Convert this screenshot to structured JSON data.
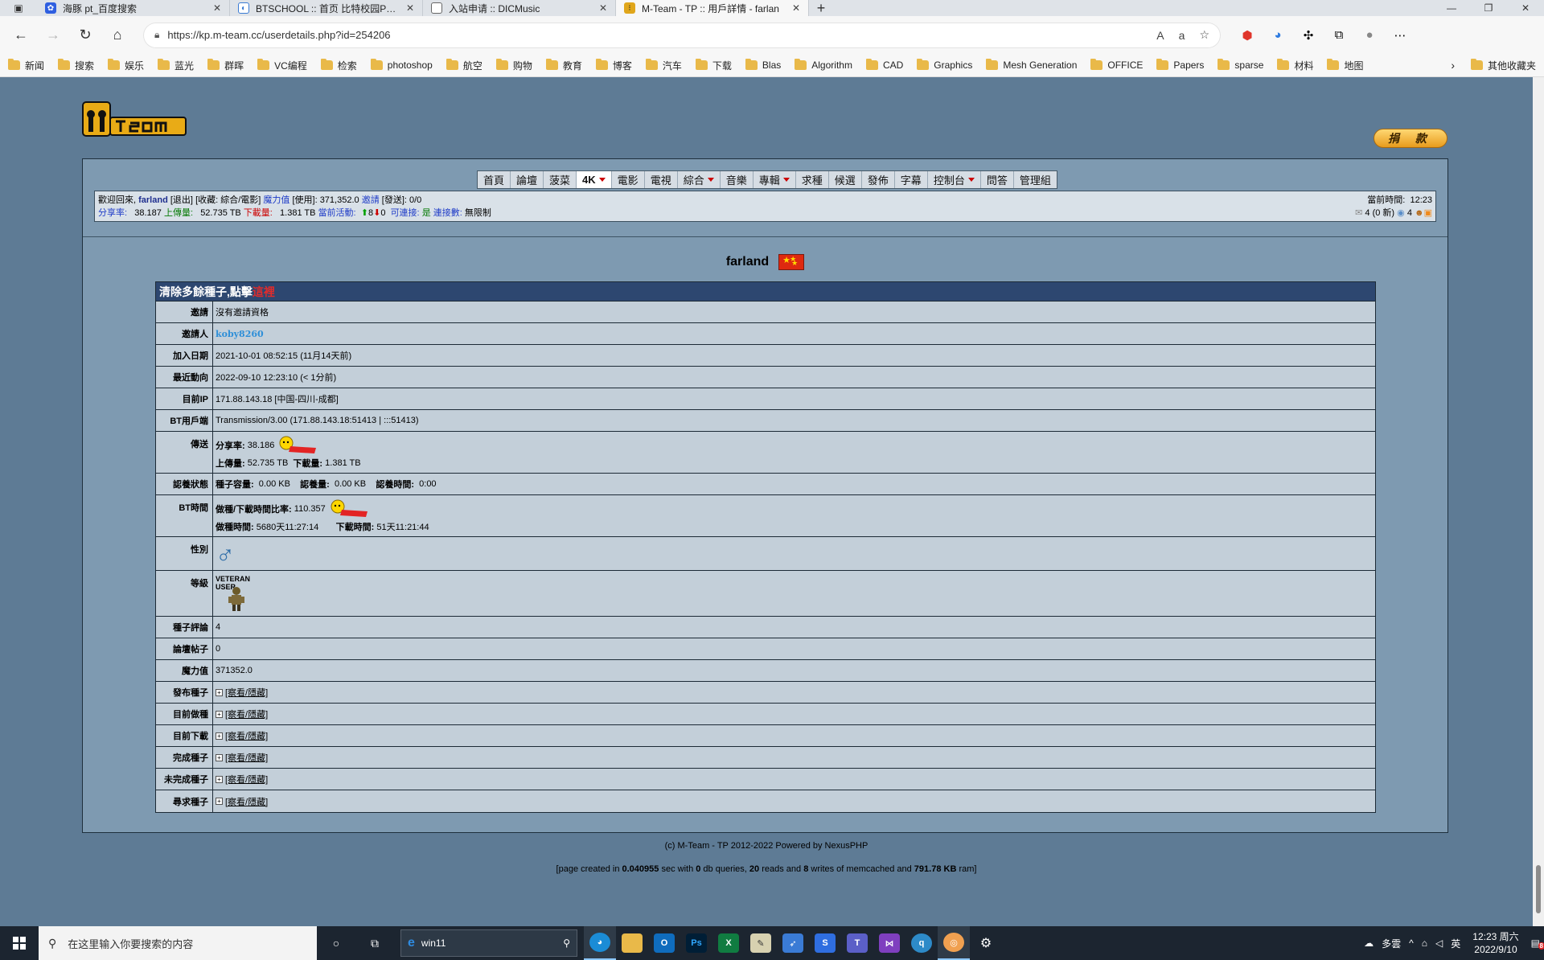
{
  "browser": {
    "tabs": [
      {
        "title": "海豚 pt_百度搜索",
        "favicon": "baidu-paw-icon",
        "active": false
      },
      {
        "title": "BTSCHOOL :: 首页 比特校园PT小",
        "favicon": "btschool-icon",
        "active": false
      },
      {
        "title": "入站申请 :: DICMusic",
        "favicon": "page-icon",
        "active": false
      },
      {
        "title": "M-Team - TP :: 用戶詳情 - farlan",
        "favicon": "mteam-icon",
        "active": true
      }
    ],
    "url": "https://kp.m-team.cc/userdetails.php?id=254206",
    "bookmarks": [
      "新闻",
      "搜索",
      "娱乐",
      "蓝光",
      "群晖",
      "VC编程",
      "检索",
      "photoshop",
      "航空",
      "购物",
      "教育",
      "博客",
      "汽车",
      "下载",
      "Blas",
      "Algorithm",
      "CAD",
      "Graphics",
      "Mesh Generation",
      "OFFICE",
      "Papers",
      "sparse",
      "材料",
      "地图"
    ],
    "bookmarks_other": "其他收藏夹"
  },
  "site": {
    "donate_label": "捐 款",
    "menu": [
      "首頁",
      "論壇",
      "菠菜",
      "4K",
      "電影",
      "電視",
      "綜合",
      "音樂",
      "專輯",
      "求種",
      "候選",
      "發佈",
      "字幕",
      "控制台",
      "問答",
      "管理組"
    ],
    "menu_selected": "4K",
    "menu_dropdowns": [
      "4K",
      "綜合",
      "專輯",
      "控制台"
    ],
    "info": {
      "welcome": "歡迎回來,",
      "username": "farland",
      "logout": "[退出]",
      "favorites": "[收藏: 綜合/電影]",
      "bonus_label": "魔力值",
      "bonus_value": "[使用]: 371,352.0",
      "invite_label": "邀請",
      "invite_value": "[發送]: 0/0",
      "ratio_label": "分享率:",
      "ratio_value": "38.187",
      "uploaded_label": "上傳量:",
      "uploaded_value": "52.735 TB",
      "downloaded_label": "下載量:",
      "downloaded_value": "1.381 TB",
      "active_label": "當前活動:",
      "active_seeding": "8",
      "active_leeching": "0",
      "connectable_label": "可連接:",
      "connectable_value": "是",
      "connections_label": "連接數:",
      "connections_value": "無限制",
      "time_label": "當前時間:",
      "time_value": "12:23",
      "messages": "4 (0 新)",
      "friends_count": "4"
    }
  },
  "profile": {
    "username": "farland",
    "clean_prefix": "清除多餘種子,點擊",
    "clean_link": "這裡",
    "rows": {
      "invite": {
        "label": "邀請",
        "value": "沒有邀請資格"
      },
      "inviter": {
        "label": "邀請人",
        "value": "koby8260"
      },
      "joined": {
        "label": "加入日期",
        "value": "2021-10-01 08:52:15 (11月14天前)"
      },
      "last_seen": {
        "label": "最近動向",
        "value": "2022-09-10 12:23:10 (< 1分前)"
      },
      "ip": {
        "label": "目前IP",
        "value": "171.88.143.18 [中国-四川-成都]"
      },
      "client": {
        "label": "BT用戶端",
        "value": "Transmission/3.00 (171.88.143.18:51413 | :::51413)"
      },
      "transfer": {
        "label": "傳送",
        "ratio_label": "分享率:",
        "ratio_value": "38.186",
        "up_label": "上傳量:",
        "up_value": "52.735 TB",
        "down_label": "下載量:",
        "down_value": "1.381 TB"
      },
      "adopt": {
        "label": "認養狀態",
        "size_label": "種子容量:",
        "size_value": "0.00 KB",
        "amount_label": "認養量:",
        "amount_value": "0.00 KB",
        "time_label": "認養時間:",
        "time_value": "0:00"
      },
      "bt_time": {
        "label": "BT時間",
        "ratio_label": "做種/下載時間比率:",
        "ratio_value": "110.357",
        "seed_label": "做種時間:",
        "seed_value": "5680天11:27:14",
        "leech_label": "下載時間:",
        "leech_value": "51天11:21:44"
      },
      "gender": {
        "label": "性別",
        "value": "♂"
      },
      "class": {
        "label": "等級",
        "value": "VETERAN USER"
      },
      "comments": {
        "label": "種子評論",
        "value": "4"
      },
      "posts": {
        "label": "論壇帖子",
        "value": "0"
      },
      "bonus": {
        "label": "魔力值",
        "value": "371352.0"
      },
      "uploaded_torrents": {
        "label": "發布種子",
        "value": "[察看/隱藏]"
      },
      "seeding": {
        "label": "目前做種",
        "value": "[察看/隱藏]"
      },
      "leeching": {
        "label": "目前下載",
        "value": "[察看/隱藏]"
      },
      "completed": {
        "label": "完成種子",
        "value": "[察看/隱藏]"
      },
      "incomplete": {
        "label": "未完成種子",
        "value": "[察看/隱藏]"
      },
      "requests": {
        "label": "尋求種子",
        "value": "[察看/隱藏]"
      }
    }
  },
  "footer": {
    "copyright": "(c) M-Team - TP 2012-2022 Powered by NexusPHP",
    "stats_prefix": "[page created in ",
    "stats_time": "0.040955",
    "stats_mid1": " sec with ",
    "stats_queries": "0",
    "stats_mid2": " db queries, ",
    "stats_reads": "20",
    "stats_mid3": " reads and ",
    "stats_writes": "8",
    "stats_mid4": " writes of memcached and ",
    "stats_ram": "791.78 KB",
    "stats_suffix": " ram]"
  },
  "taskbar": {
    "search_placeholder": "在这里输入你要搜索的内容",
    "ie_text": "win11",
    "weather": "多雲",
    "ime": "英",
    "time": "12:23 周六",
    "date": "2022/9/10",
    "notification_count": "8"
  },
  "colors": {
    "page_bg": "#5e7b95",
    "table_head": "#2d4770",
    "link_blue": "#2e8fd8",
    "here_red": "#e02c2c"
  }
}
